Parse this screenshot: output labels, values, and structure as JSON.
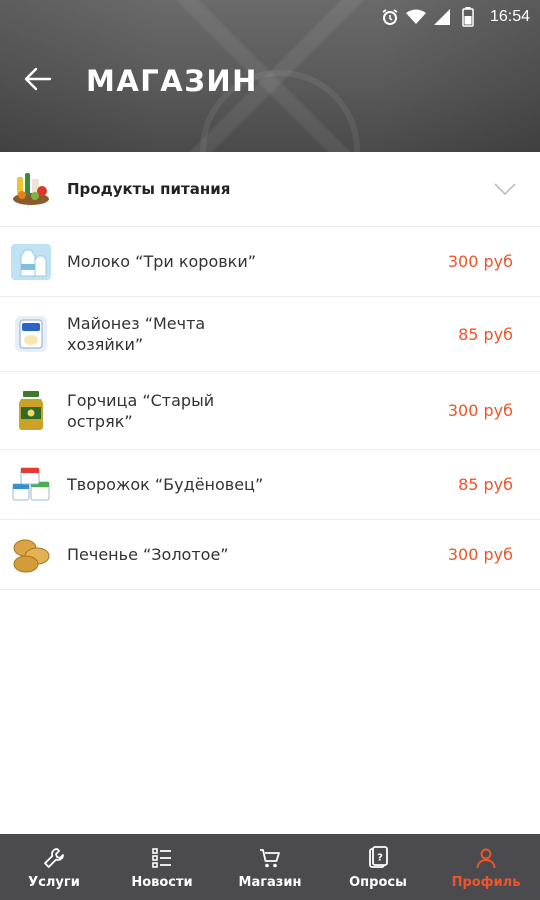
{
  "status_bar": {
    "time": "16:54",
    "icons": [
      "alarm-icon",
      "wifi-icon",
      "signal-icon",
      "battery-icon"
    ]
  },
  "app_bar": {
    "back_icon": "arrow-left-icon",
    "title": "МАГАЗИН"
  },
  "category": {
    "label": "Продукты питания",
    "icon": "groceries-icon",
    "expand_icon": "chevron-down-icon"
  },
  "products": [
    {
      "name": "Молоко “Три коровки”",
      "price": "300 руб",
      "icon": "milk-icon"
    },
    {
      "name": "Майонез “Мечта хозяйки”",
      "price": "85 руб",
      "icon": "mayonnaise-icon"
    },
    {
      "name": "Горчица “Старый остряк”",
      "price": "300 руб",
      "icon": "mustard-icon"
    },
    {
      "name": "Творожок “Будёновец”",
      "price": "85 руб",
      "icon": "curd-icon"
    },
    {
      "name": "Печенье “Золотое”",
      "price": "300 руб",
      "icon": "cookies-icon"
    }
  ],
  "bottom_nav": [
    {
      "label": "Услуги",
      "icon": "wrench-icon",
      "active": false
    },
    {
      "label": "Новости",
      "icon": "list-icon",
      "active": false
    },
    {
      "label": "Магазин",
      "icon": "cart-icon",
      "active": false
    },
    {
      "label": "Опросы",
      "icon": "survey-icon",
      "active": false
    },
    {
      "label": "Профиль",
      "icon": "person-icon",
      "active": true
    }
  ],
  "colors": {
    "accent": "#f0542a",
    "nav_bg": "#4b4b4f",
    "header_bg": "#5f5f5f"
  }
}
